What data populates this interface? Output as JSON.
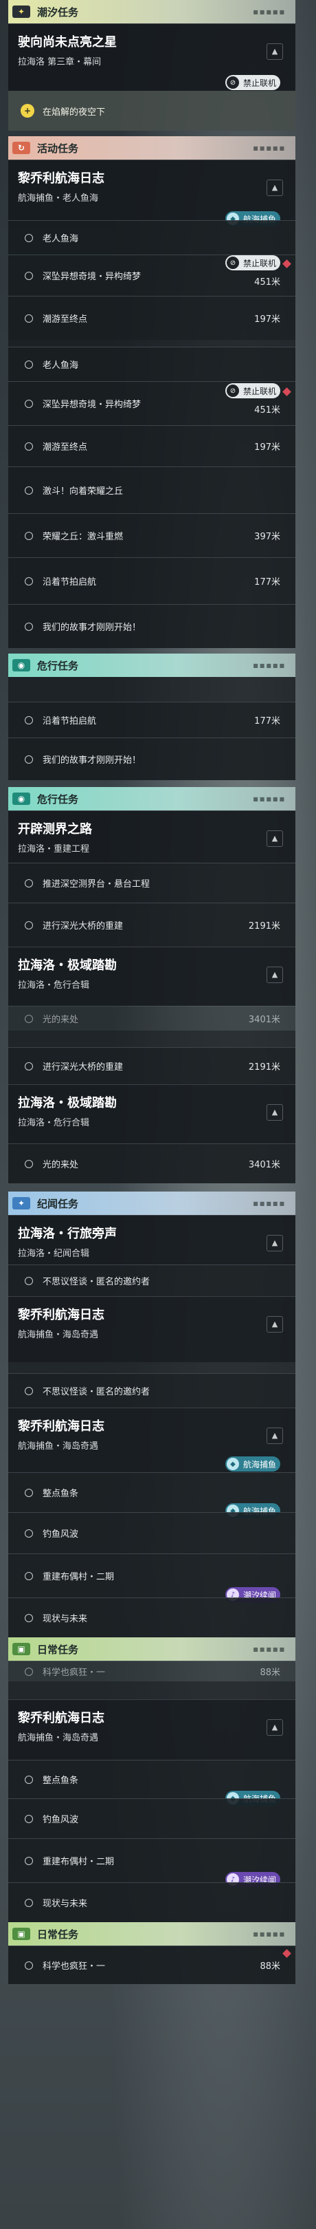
{
  "badges": {
    "ban": "禁止联机",
    "sea": "航海捕鱼",
    "tide": "潮汐续闻"
  },
  "sections": {
    "tide": "潮汐任务",
    "activity": "活动任务",
    "danger": "危行任务",
    "story": "纪闻任务",
    "daily": "日常任务"
  },
  "tide_card": {
    "title": "驶向尚未点亮之星",
    "subtitle": "拉海洛 第三章・幕间"
  },
  "notice": "在焰解的夜空下",
  "cards": {
    "voyage_a": {
      "title": "黎乔利航海日志",
      "subtitle": "航海捕鱼・老人鱼海"
    },
    "pioneer": {
      "title": "开辟测界之路",
      "subtitle": "拉海洛・重建工程"
    },
    "extreme": {
      "title": "拉海洛・极域踏勘",
      "subtitle": "拉海洛・危行合辑"
    },
    "whisper": {
      "title": "拉海洛・行旅旁声",
      "subtitle": "拉海洛・纪闻合辑"
    },
    "voyage_b": {
      "title": "黎乔利航海日志",
      "subtitle": "航海捕鱼・海岛奇遇"
    }
  },
  "rows": {
    "old_fish": "老人鱼海",
    "abyss": "深坠异想奇境・异构绮梦",
    "abyss_d": "451米",
    "tide_end": "潮游至终点",
    "tide_end_d": "197米",
    "march": "激斗！向着荣耀之丘",
    "glory": "荣耀之丘：激斗重燃",
    "glory_d": "397米",
    "festival": "沿着节拍启航",
    "festival_d": "177米",
    "story_start": "我们的故事才刚刚开始！",
    "platform": "推进深空测界台・悬台工程",
    "bridge": "进行深光大桥的重建",
    "bridge_d": "2191米",
    "light": "光的来处",
    "light_d": "3401米",
    "light_partial": "光的来处",
    "light_partial_d": "3401米",
    "invite": "不思议怪谈・匿名的邀约者",
    "gulls": "整点鱼条",
    "fishing": "钓鱼风波",
    "rebuild": "重建布偶村・二期",
    "future": "现状与未来",
    "science": "科学也疯狂・一",
    "science_d": "88米"
  }
}
